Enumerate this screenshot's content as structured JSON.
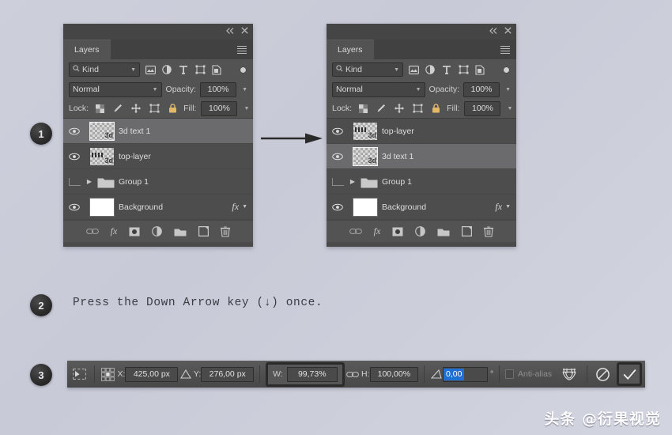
{
  "page": {
    "background_color": "#cbcdd9",
    "watermark": "头条 @衍果视觉"
  },
  "steps": [
    {
      "number": "1"
    },
    {
      "number": "2",
      "text": "Press the Down Arrow key (↓) once."
    },
    {
      "number": "3"
    }
  ],
  "panels": [
    {
      "id": "before",
      "tab_label": "Layers",
      "collapse_label": "◄◄",
      "close_label": "✕",
      "filter": {
        "kind_label": "Kind",
        "search_icon": "search-icon",
        "filter_icons": [
          "image-filter-icon",
          "adjustment-filter-icon",
          "type-filter-icon",
          "shape-filter-icon",
          "smart-object-filter-icon"
        ],
        "toggle": "filter-toggle"
      },
      "blend": {
        "mode": "Normal",
        "opacity_label": "Opacity:",
        "opacity_value": "100%"
      },
      "lock": {
        "label": "Lock:",
        "icons": [
          "lock-transparent-pixels-icon",
          "lock-image-pixels-icon",
          "lock-position-icon",
          "lock-artboard-icon",
          "lock-all-icon"
        ],
        "fill_label": "Fill:",
        "fill_value": "100%"
      },
      "layers": [
        {
          "name": "3d text 1",
          "visible": true,
          "selected": true,
          "thumb": "transparent-3d-text",
          "has_fx": false,
          "type": "layer"
        },
        {
          "name": "top-layer",
          "visible": true,
          "selected": false,
          "thumb": "transparent-top-layer",
          "has_fx": false,
          "type": "layer"
        },
        {
          "name": "Group 1",
          "visible": false,
          "selected": false,
          "thumb": "folder",
          "has_fx": false,
          "type": "group"
        },
        {
          "name": "Background",
          "visible": true,
          "selected": false,
          "thumb": "white",
          "has_fx": true,
          "type": "layer"
        }
      ],
      "footer_icons": [
        "link-layers-icon",
        "add-fx-icon",
        "add-mask-icon",
        "new-adjustment-layer-icon",
        "new-group-icon",
        "new-layer-icon",
        "delete-layer-icon"
      ]
    },
    {
      "id": "after",
      "tab_label": "Layers",
      "collapse_label": "◄◄",
      "close_label": "✕",
      "filter": {
        "kind_label": "Kind",
        "search_icon": "search-icon",
        "filter_icons": [
          "image-filter-icon",
          "adjustment-filter-icon",
          "type-filter-icon",
          "shape-filter-icon",
          "smart-object-filter-icon"
        ],
        "toggle": "filter-toggle"
      },
      "blend": {
        "mode": "Normal",
        "opacity_label": "Opacity:",
        "opacity_value": "100%"
      },
      "lock": {
        "label": "Lock:",
        "icons": [
          "lock-transparent-pixels-icon",
          "lock-image-pixels-icon",
          "lock-position-icon",
          "lock-artboard-icon",
          "lock-all-icon"
        ],
        "fill_label": "Fill:",
        "fill_value": "100%"
      },
      "layers": [
        {
          "name": "top-layer",
          "visible": true,
          "selected": false,
          "thumb": "transparent-top-layer",
          "has_fx": false,
          "type": "layer"
        },
        {
          "name": "3d text 1",
          "visible": true,
          "selected": true,
          "thumb": "transparent-3d-text",
          "has_fx": false,
          "type": "layer"
        },
        {
          "name": "Group 1",
          "visible": false,
          "selected": false,
          "thumb": "folder",
          "has_fx": false,
          "type": "group"
        },
        {
          "name": "Background",
          "visible": true,
          "selected": false,
          "thumb": "white",
          "has_fx": true,
          "type": "layer"
        }
      ],
      "footer_icons": [
        "link-layers-icon",
        "add-fx-icon",
        "add-mask-icon",
        "new-adjustment-layer-icon",
        "new-group-icon",
        "new-layer-icon",
        "delete-layer-icon"
      ]
    }
  ],
  "options_bar": {
    "tool_icon": "free-transform-tool-icon",
    "reference_point_icon": "reference-point-grid-icon",
    "x_label": "X:",
    "x_value": "425,00 px",
    "delta_icon": "relative-position-icon",
    "y_label": "Y:",
    "y_value": "276,00 px",
    "w_label": "W:",
    "w_value": "99,73%",
    "link_icon": "maintain-aspect-ratio-icon",
    "h_label": "H:",
    "h_value": "100,00%",
    "angle_icon": "rotate-angle-icon",
    "angle_value": "0,00",
    "angle_unit": "°",
    "shear_icon": "shear-icon",
    "antialias_label": "Anti-alias",
    "warp_icon": "warp-mode-icon",
    "cancel_icon": "cancel-transform-icon",
    "commit_icon": "commit-transform-icon",
    "highlight_color": "#2b2b2b",
    "selection_color": "#1f6fd4"
  }
}
